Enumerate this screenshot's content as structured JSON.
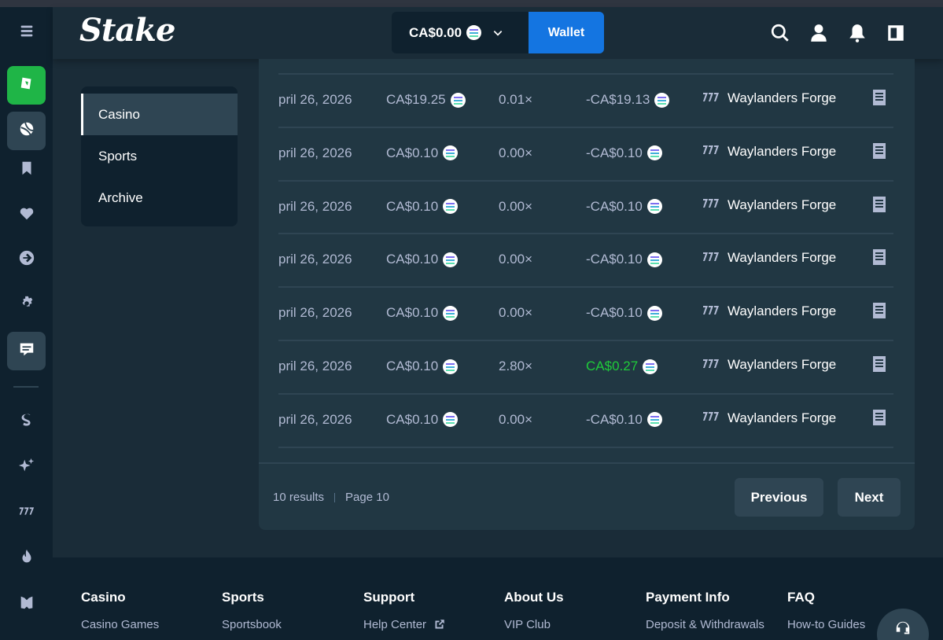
{
  "header": {
    "logo": "Stake",
    "balance": "CA$0.00",
    "wallet_label": "Wallet"
  },
  "rail": {
    "items": [
      "menu-icon",
      "casino-icon",
      "sports-icon",
      "bookmark-icon",
      "heart-icon",
      "arrow-right-circle-icon",
      "gear-icon",
      "transactions-icon",
      "stake-originals-icon",
      "sparkle-icon",
      "slots-777-icon",
      "fire-icon",
      "gift-icon"
    ]
  },
  "subnav": {
    "items": [
      {
        "label": "Casino",
        "active": true
      },
      {
        "label": "Sports",
        "active": false
      },
      {
        "label": "Archive",
        "active": false
      }
    ]
  },
  "table": {
    "rows": [
      {
        "date": "pril 26, 2026",
        "bet": "CA$19.25",
        "multiplier": "0.01×",
        "payout": "-CA$19.13",
        "win": false,
        "game": "Waylanders Forge"
      },
      {
        "date": "pril 26, 2026",
        "bet": "CA$0.10",
        "multiplier": "0.00×",
        "payout": "-CA$0.10",
        "win": false,
        "game": "Waylanders Forge"
      },
      {
        "date": "pril 26, 2026",
        "bet": "CA$0.10",
        "multiplier": "0.00×",
        "payout": "-CA$0.10",
        "win": false,
        "game": "Waylanders Forge"
      },
      {
        "date": "pril 26, 2026",
        "bet": "CA$0.10",
        "multiplier": "0.00×",
        "payout": "-CA$0.10",
        "win": false,
        "game": "Waylanders Forge"
      },
      {
        "date": "pril 26, 2026",
        "bet": "CA$0.10",
        "multiplier": "0.00×",
        "payout": "-CA$0.10",
        "win": false,
        "game": "Waylanders Forge"
      },
      {
        "date": "pril 26, 2026",
        "bet": "CA$0.10",
        "multiplier": "2.80×",
        "payout": "CA$0.27",
        "win": true,
        "game": "Waylanders Forge"
      },
      {
        "date": "pril 26, 2026",
        "bet": "CA$0.10",
        "multiplier": "0.00×",
        "payout": "-CA$0.10",
        "win": false,
        "game": "Waylanders Forge"
      }
    ]
  },
  "pagination": {
    "results": "10 results",
    "page": "Page 10",
    "previous": "Previous",
    "next": "Next"
  },
  "footer": {
    "columns": [
      {
        "heading": "Casino",
        "link": "Casino Games",
        "external": false
      },
      {
        "heading": "Sports",
        "link": "Sportsbook",
        "external": false
      },
      {
        "heading": "Support",
        "link": "Help Center",
        "external": true
      },
      {
        "heading": "About Us",
        "link": "VIP Club",
        "external": false
      },
      {
        "heading": "Payment Info",
        "link": "Deposit & Withdrawals",
        "external": false
      },
      {
        "heading": "FAQ",
        "link": "How-to Guides",
        "external": false
      }
    ]
  },
  "colors": {
    "background": "#1a2c38",
    "panel": "#213743",
    "dark": "#0f212e",
    "accent_blue": "#1475e1",
    "win_green": "#1fcc3a",
    "muted_text": "#b1bad3"
  }
}
